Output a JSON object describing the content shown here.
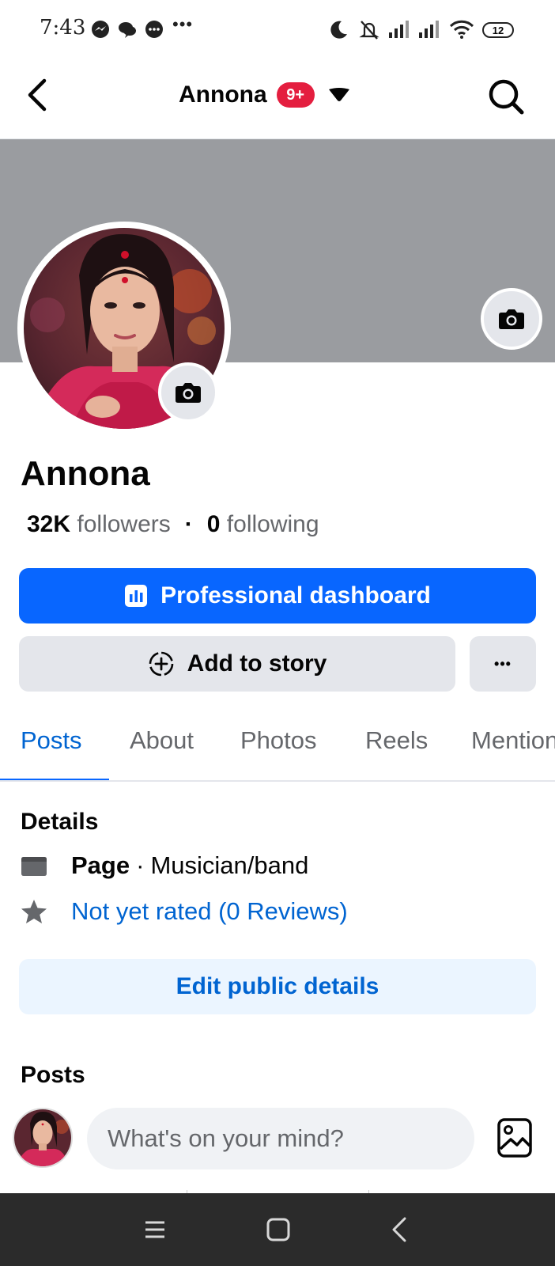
{
  "status_bar": {
    "time": "7:43",
    "overflow": "•••",
    "battery": "12",
    "left_icons": [
      "messenger-icon",
      "chat-bubbles-icon",
      "chat-icon"
    ],
    "right_icons": [
      "moon-icon",
      "bell-muted-icon",
      "signal-icon",
      "signal-icon",
      "wifi-icon",
      "battery-icon"
    ]
  },
  "header": {
    "title": "Annona",
    "badge": "9+",
    "icons": [
      "back-arrow-icon",
      "caret-down-icon",
      "search-icon"
    ]
  },
  "profile": {
    "name": "Annona",
    "followers_count": "32K",
    "followers_label": "followers",
    "separator": "·",
    "following_count": "0",
    "following_label": "following"
  },
  "actions": {
    "dashboard_label": "Professional dashboard",
    "add_story_label": "Add to story",
    "more_label": "•••"
  },
  "tabs": [
    {
      "label": "Posts",
      "active": true
    },
    {
      "label": "About",
      "active": false
    },
    {
      "label": "Photos",
      "active": false
    },
    {
      "label": "Reels",
      "active": false
    },
    {
      "label": "Mentions",
      "active": false
    }
  ],
  "details": {
    "title": "Details",
    "page_label": "Page",
    "separator": "·",
    "category": "Musician/band",
    "rating": "Not yet rated (0 Reviews)",
    "edit_label": "Edit public details"
  },
  "posts": {
    "title": "Posts",
    "composer_placeholder": "What's on your mind?"
  },
  "colors": {
    "primary": "#0866ff",
    "link": "#0064d1",
    "badge": "#e41e3f",
    "cover": "#9a9ca0",
    "secondary_button": "#e4e6eb",
    "edit_button": "#ebf5ff"
  }
}
